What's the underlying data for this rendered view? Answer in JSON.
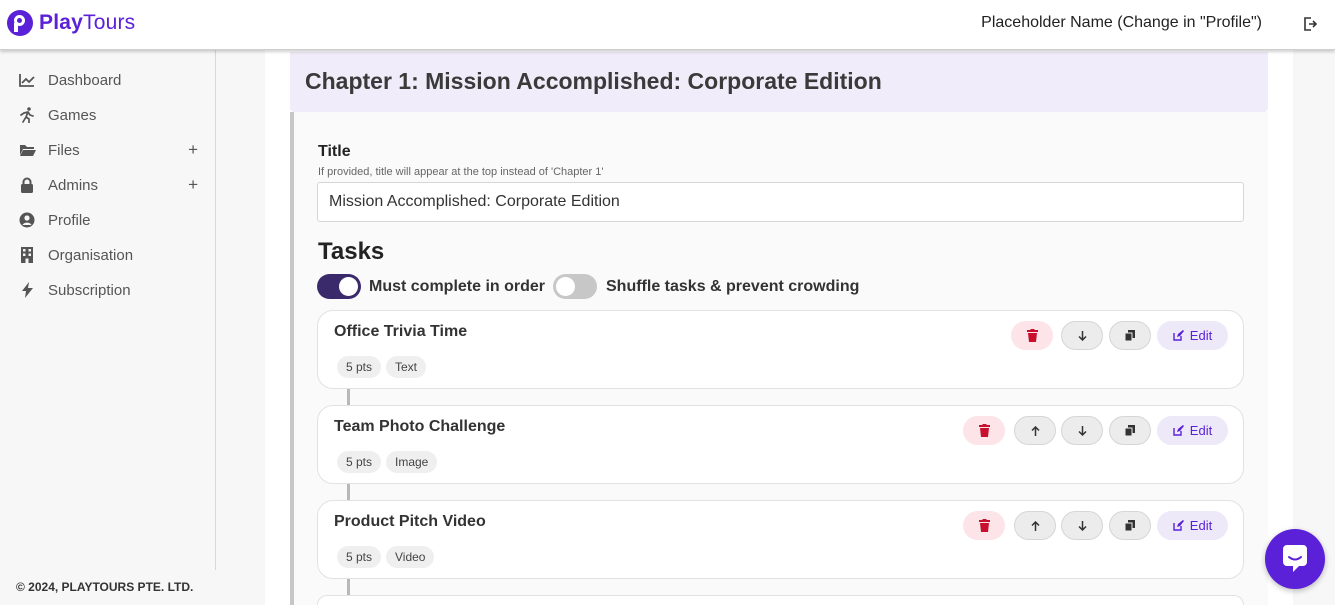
{
  "app": {
    "logo_play": "Play",
    "logo_tours": "Tours"
  },
  "header": {
    "user_name": "Placeholder Name (Change in \"Profile\")"
  },
  "sidebar": {
    "items": [
      {
        "label": "Dashboard",
        "icon": "chart-line-icon"
      },
      {
        "label": "Games",
        "icon": "running-icon"
      },
      {
        "label": "Files",
        "icon": "folder-icon",
        "plus": "+"
      },
      {
        "label": "Admins",
        "icon": "lock-icon",
        "plus": "+"
      },
      {
        "label": "Profile",
        "icon": "user-circle-icon"
      },
      {
        "label": "Organisation",
        "icon": "building-icon"
      },
      {
        "label": "Subscription",
        "icon": "bolt-icon"
      }
    ],
    "footer": "© 2024, PLAYTOURS PTE. LTD."
  },
  "chapter": {
    "heading": "Chapter 1: Mission Accomplished: Corporate Edition",
    "title_label": "Title",
    "title_help": "If provided, title will appear at the top instead of 'Chapter 1'",
    "title_value": "Mission Accomplished: Corporate Edition"
  },
  "tasks": {
    "heading": "Tasks",
    "toggle_order": {
      "label": "Must complete in order",
      "on": true
    },
    "toggle_shuffle": {
      "label": "Shuffle tasks & prevent crowding",
      "on": false
    },
    "edit_label": "Edit",
    "items": [
      {
        "name": "Office Trivia Time",
        "points": "5 pts",
        "type": "Text"
      },
      {
        "name": "Team Photo Challenge",
        "points": "5 pts",
        "type": "Image"
      },
      {
        "name": "Product Pitch Video",
        "points": "5 pts",
        "type": "Video"
      }
    ]
  },
  "colors": {
    "brand": "#5b21d8",
    "toggle_on": "#3b2a6b",
    "delete": "#c8102e"
  }
}
